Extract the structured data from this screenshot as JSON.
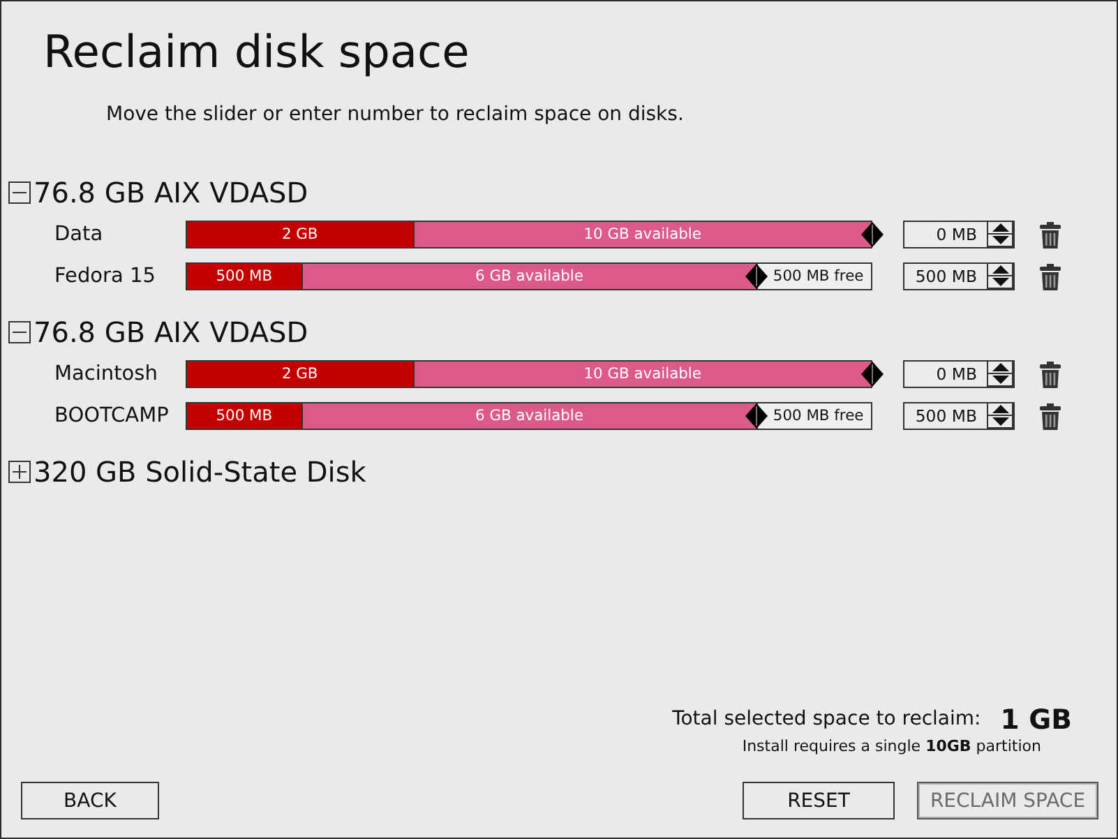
{
  "window": {
    "title": "Reclaim disk space",
    "instructions": "Move the slider or enter number to reclaim space on disks."
  },
  "disks": [
    {
      "name": "76.8 GB AIX VDASD",
      "expanded": true,
      "partitions": [
        {
          "name": "Data",
          "used": {
            "label": "2 GB",
            "level": 0.33
          },
          "available": {
            "label": "10 GB available"
          },
          "level": 1,
          "amount": "0 MB"
        },
        {
          "name": "Fedora 15",
          "used": {
            "label": "500 MB",
            "level": 0.167
          },
          "available": {
            "label": "6 GB available"
          },
          "free": {
            "label": "500 MB free"
          },
          "level": 0.832,
          "amount": "500 MB"
        }
      ]
    },
    {
      "name": "76.8 GB AIX VDASD",
      "expanded": true,
      "partitions": [
        {
          "name": "Macintosh",
          "used": {
            "label": "2 GB",
            "level": 0.33
          },
          "available": {
            "label": "10 GB available"
          },
          "level": 1,
          "amount": "0 MB"
        },
        {
          "name": "BOOTCAMP",
          "used": {
            "label": "500 MB",
            "level": 0.167
          },
          "available": {
            "label": "6 GB available"
          },
          "free": {
            "label": "500 MB free"
          },
          "level": 0.832,
          "amount": "500 MB"
        }
      ]
    },
    {
      "name": "320 GB Solid-State Disk",
      "expanded": false
    }
  ],
  "summary": {
    "label": "Total selected space to reclaim:",
    "total": "1 GB",
    "note": "Install requires a single **10GB** partition"
  },
  "navigation": [
    {
      "label": "BACK",
      "disabled": false
    }
  ],
  "actions": [
    {
      "label": "RESET",
      "disabled": false
    },
    {
      "label": "RECLAIM SPACE",
      "disabled": true
    }
  ]
}
